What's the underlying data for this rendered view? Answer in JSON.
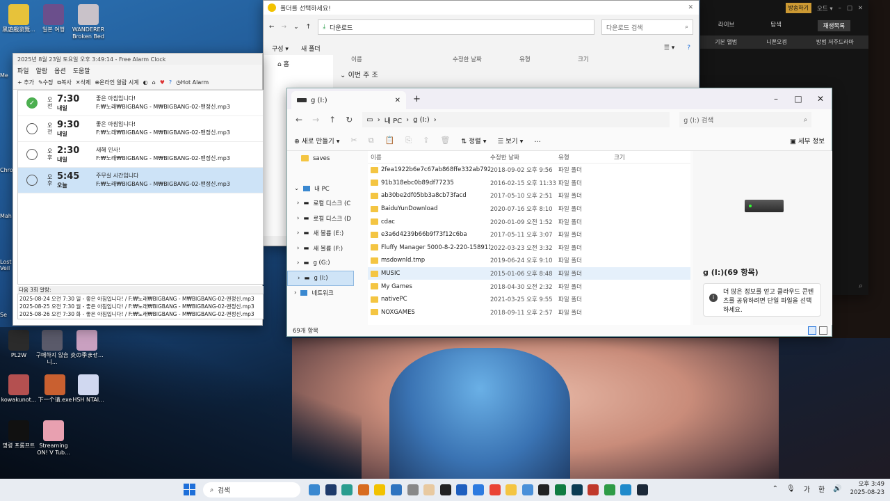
{
  "desktop": {
    "icons": [
      {
        "label": "黑遊戲瀏覽...",
        "color": "#e7c23a"
      },
      {
        "label": "일본 여행",
        "color": "#6b4f8c"
      },
      {
        "label": "WANDERER Broken Bed",
        "color": "#c9c2c9"
      },
      {
        "label": "PL2W",
        "color": "#2b2b2b"
      },
      {
        "label": "구매하지 않습니...",
        "color": "#5a5a6a"
      },
      {
        "label": "炎の季ませ...",
        "color": "#c9a0c0"
      },
      {
        "label": "kowakunot...",
        "color": "#b45050"
      },
      {
        "label": "下一个请.exe",
        "color": "#c96030"
      },
      {
        "label": "HSH NTAI...",
        "color": "#d0d8f0"
      },
      {
        "label": "명령 프롬프트",
        "color": "#111111"
      },
      {
        "label": "Streaming ON! V Tub...",
        "color": "#e8a0b0"
      }
    ],
    "edge_labels": [
      "Me",
      "Chro",
      "Mah",
      "Lost Veil",
      "Se"
    ]
  },
  "alarm": {
    "title": "2025년 8월 23일 토요일 오후 3:49:14 - Free Alarm Clock",
    "menu": [
      "파일",
      "알람",
      "옵션",
      "도움말"
    ],
    "toolbar": [
      "추가",
      "수정",
      "복사",
      "삭제",
      "온라인 알람 시계",
      "Hot Alarm"
    ],
    "alarms": [
      {
        "ampm": "오전",
        "time": "7:30",
        "day": "내일",
        "msg": "좋은 아침입니다!",
        "file": "F:₩노래₩BIGBANG - M₩BIGBANG-02-맨정신.mp3",
        "on": true
      },
      {
        "ampm": "오전",
        "time": "9:30",
        "day": "내일",
        "msg": "좋은 아침입니다!",
        "file": "F:₩노래₩BIGBANG - M₩BIGBANG-02-맨정신.mp3",
        "on": false
      },
      {
        "ampm": "오후",
        "time": "2:30",
        "day": "내일",
        "msg": "새해 인사!",
        "file": "F:₩노래₩BIGBANG - M₩BIGBANG-02-맨정신.mp3",
        "on": false
      },
      {
        "ampm": "오후",
        "time": "5:45",
        "day": "오늘",
        "msg": "주무실 시간입니다",
        "file": "F:₩노래₩BIGBANG - M₩BIGBANG-02-맨정신.mp3",
        "on": false
      }
    ],
    "next_header": "다음 3회 알람:",
    "next": [
      "2025-08-24 오전 7:30 일 - 좋은 아침입니다! / F:₩노래₩BIGBANG - M₩BIGBANG-02-맨정신.mp3",
      "2025-08-25 오전 7:30 월 - 좋은 아침입니다! / F:₩노래₩BIGBANG - M₩BIGBANG-02-맨정신.mp3",
      "2025-08-26 오전 7:30 화 - 좋은 아침입니다! / F:₩노래₩BIGBANG - M₩BIGBANG-02-맨정신.mp3"
    ]
  },
  "picker": {
    "title": "폴더를 선택하세요!",
    "path": "다운로드",
    "search_placeholder": "다운로드 검색",
    "cmd": [
      "구성 ▾",
      "새 폴더"
    ],
    "headers": [
      "이름",
      "수정한 날짜",
      "유형",
      "크기"
    ],
    "group": "이번 주 조",
    "nav_home": "홈"
  },
  "explorer": {
    "tab_title": "g (I:)",
    "crumbs": [
      "내 PC",
      "g (I:)"
    ],
    "search_placeholder": "g (I:) 검색",
    "cmd": {
      "new": "새로 만들기",
      "sort": "정렬",
      "view": "보기",
      "more": "…",
      "details": "세부 정보"
    },
    "nav": [
      {
        "label": "saves",
        "sel": false
      },
      {
        "label": "",
        "sel": false
      },
      {
        "label": "내 PC",
        "sel": false
      },
      {
        "label": "로컬 디스크 (C",
        "sel": false
      },
      {
        "label": "로컬 디스크 (D",
        "sel": false
      },
      {
        "label": "새 볼륨 (E:)",
        "sel": false
      },
      {
        "label": "새 볼륨 (F:)",
        "sel": false
      },
      {
        "label": "g (G:)",
        "sel": false
      },
      {
        "label": "g (I:)",
        "sel": true
      },
      {
        "label": "네트워크",
        "sel": false
      }
    ],
    "headers": [
      "이름",
      "수정한 날짜",
      "유형",
      "크기"
    ],
    "files": [
      {
        "name": "2fea1922b6e7c67ab868ffe332ab792d",
        "date": "2018-09-02 오후 9:56",
        "type": "파일 폴더"
      },
      {
        "name": "91b318ebc0b89df77235",
        "date": "2016-02-15 오후 11:33",
        "type": "파일 폴더"
      },
      {
        "name": "ab30be2df05bb3a8cb73facd",
        "date": "2017-05-10 오후 2:51",
        "type": "파일 폴더"
      },
      {
        "name": "BaiduYunDownload",
        "date": "2020-07-16 오후 8:10",
        "type": "파일 폴더"
      },
      {
        "name": "cdac",
        "date": "2020-01-09 오전 1:52",
        "type": "파일 폴더"
      },
      {
        "name": "e3a6d4239b66b9f73f12c6ba",
        "date": "2017-05-11 오후 3:07",
        "type": "파일 폴더"
      },
      {
        "name": "Fluffy Manager 5000-8-2-220-1589117...",
        "date": "2022-03-23 오전 3:32",
        "type": "파일 폴더"
      },
      {
        "name": "msdownld.tmp",
        "date": "2019-06-24 오후 9:10",
        "type": "파일 폴더"
      },
      {
        "name": "MUSIC",
        "date": "2015-01-06 오후 8:48",
        "type": "파일 폴더",
        "sel": true
      },
      {
        "name": "My Games",
        "date": "2018-04-30 오전 2:32",
        "type": "파일 폴더"
      },
      {
        "name": "nativePC",
        "date": "2021-03-25 오후 9:55",
        "type": "파일 폴더"
      },
      {
        "name": "NOXGAMES",
        "date": "2018-09-11 오후 2:57",
        "type": "파일 폴더"
      }
    ],
    "detail_title": "g (I:)(69 항목)",
    "detail_info": "더 많은 정보를 얻고 클라우드 콘텐츠를 공유하려면 단일 파일을 선택하세요.",
    "status": "69개 항목"
  },
  "music": {
    "top": [
      "방송하기",
      "오드 ▾"
    ],
    "tabs": [
      "라이브",
      "탐색",
      "재생목록"
    ],
    "subtabs": [
      "기본 앨범",
      "니뽄오겜",
      "방범 저주드라마"
    ]
  },
  "taskbar": {
    "search": "검색",
    "ime": "가",
    "lang": "한",
    "time": "오후 3:49",
    "date": "2025-08-23",
    "apps": [
      "#3a88d0",
      "#1f3b6b",
      "#2a9d8f",
      "#d86b1f",
      "#f2c200",
      "#2f74c0",
      "#888888",
      "#e8c9a0",
      "#222222",
      "#1f5fbf",
      "#2d7be0",
      "#ea4335",
      "#f4c542",
      "#4a90d9",
      "#222222",
      "#107c41",
      "#0b3b52",
      "#c0392b",
      "#2e9b46",
      "#1f8acb",
      "#1b2838"
    ]
  }
}
